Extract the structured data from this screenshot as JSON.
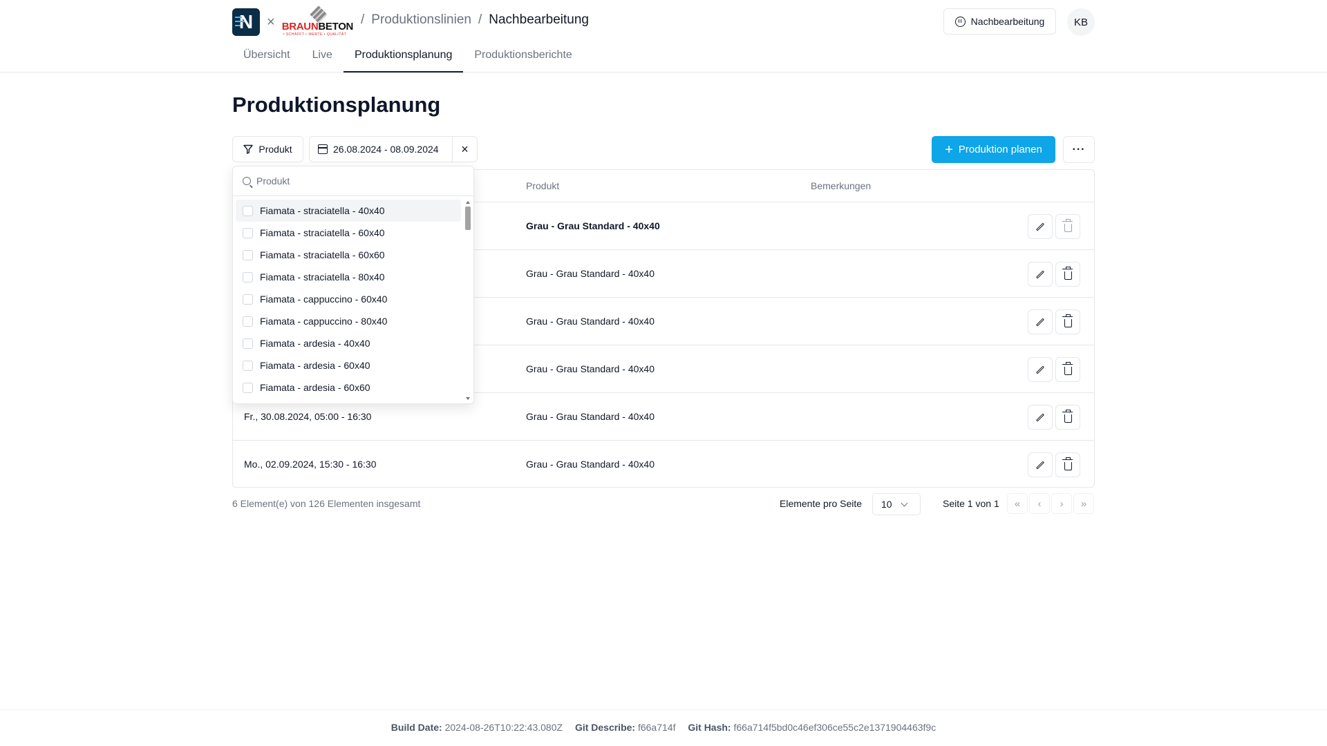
{
  "header": {
    "logo_n": "N",
    "logo_times": "×",
    "brand_word_red": "BRAUN",
    "brand_word_black": "BETON",
    "brand_sub": "• SCHAFFT • WERTE • QUALITÄT",
    "breadcrumb": [
      {
        "sep": "/",
        "label": "Produktionslinien"
      },
      {
        "sep": "/",
        "label": "Nachbearbeitung"
      }
    ],
    "status_button": "Nachbearbeitung",
    "avatar_initials": "KB",
    "tabs": [
      "Übersicht",
      "Live",
      "Produktionsplanung",
      "Produktionsberichte"
    ],
    "active_tab": "Produktionsplanung"
  },
  "page": {
    "title": "Produktionsplanung",
    "filter_product_label": "Produkt",
    "date_range": "26.08.2024 - 08.09.2024",
    "clear_icon": "×",
    "plan_button": "Produktion planen",
    "plan_plus": "+",
    "more_button": "···",
    "primary_color": "#0ea5e9"
  },
  "table": {
    "columns": [
      "Produkt",
      "Bemerkungen"
    ],
    "rows": [
      {
        "date": "",
        "product": "Grau - Grau Standard - 40x40",
        "remarks": ""
      },
      {
        "date": "",
        "product": "Grau - Grau Standard - 40x40",
        "remarks": ""
      },
      {
        "date": "",
        "product": "Grau - Grau Standard - 40x40",
        "remarks": ""
      },
      {
        "date": "",
        "product": "Grau - Grau Standard - 40x40",
        "remarks": ""
      },
      {
        "date": "Fr., 30.08.2024, 05:00 - 16:30",
        "product": "Grau - Grau Standard - 40x40",
        "remarks": ""
      },
      {
        "date": "Mo., 02.09.2024, 15:30 - 16:30",
        "product": "Grau - Grau Standard - 40x40",
        "remarks": ""
      }
    ]
  },
  "pagination": {
    "summary": "6 Element(e) von 126 Elementen insgesamt",
    "per_page_label": "Elemente pro Seite",
    "per_page_value": "10",
    "page_info": "Seite 1 von 1",
    "first": "«",
    "prev": "‹",
    "next": "›",
    "last": "»"
  },
  "dropdown": {
    "search_placeholder": "Produkt",
    "options": [
      "Fiamata - straciatella - 40x40",
      "Fiamata - straciatella - 60x40",
      "Fiamata - straciatella - 60x60",
      "Fiamata - straciatella - 80x40",
      "Fiamata - cappuccino - 60x40",
      "Fiamata - cappuccino - 80x40",
      "Fiamata - ardesia - 40x40",
      "Fiamata - ardesia - 60x40",
      "Fiamata - ardesia - 60x60"
    ]
  },
  "build": {
    "date_label": "Build Date:",
    "date_value": "2024-08-26T10:22:43.080Z",
    "describe_label": "Git Describe:",
    "describe_value": "f66a714f",
    "hash_label": "Git Hash:",
    "hash_value": "f66a714f5bd0c46ef306ce55c2e1371904463f9c"
  }
}
